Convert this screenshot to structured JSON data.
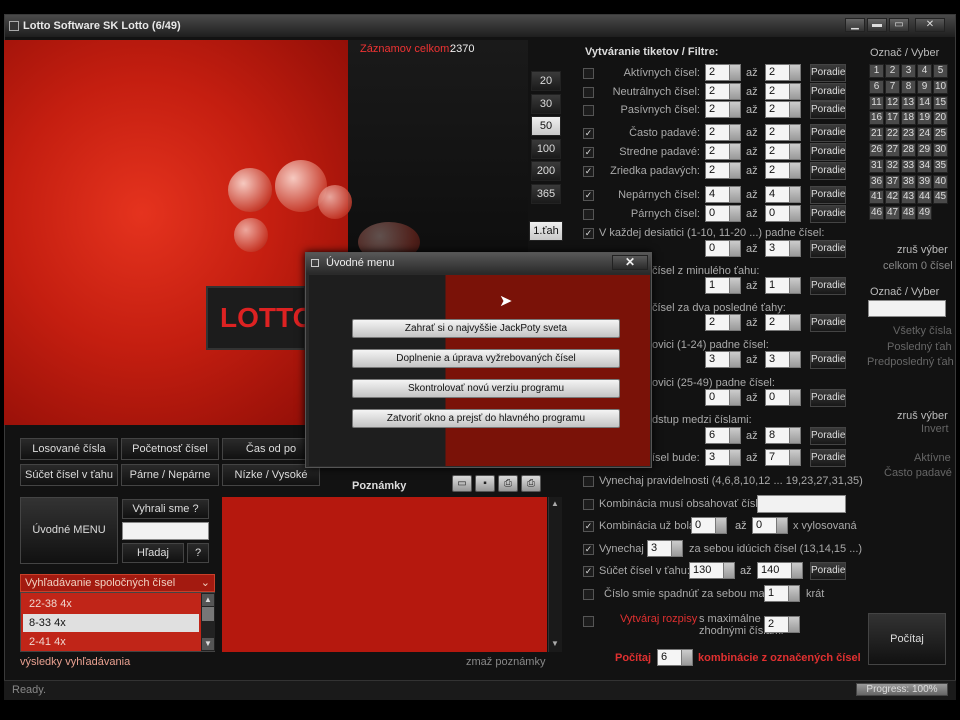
{
  "window": {
    "title": "Lotto Software SK Lotto (6/49)"
  },
  "records": {
    "label": "Záznamov celkom:",
    "value": "2370"
  },
  "logo_text": "LOTTO",
  "ranges": [
    "20",
    "30",
    "50",
    "100",
    "200",
    "365"
  ],
  "range_extra": "1.ťah",
  "nav_buttons": [
    "Losované čísla",
    "Početnosť čísel",
    "Čas od po",
    "Súčet čísel v ťahu",
    "Párne / Nepárne",
    "Nízke / Vysoké"
  ],
  "main_menu_label": "Úvodné MENU",
  "won_label": "Vyhrali sme ?",
  "search_label": "Hľadaj",
  "help_label": "?",
  "common_search": {
    "header": "Vyhľadávanie spoločných čísel",
    "items": [
      "22-38 4x",
      "8-33 4x",
      "2-41 4x"
    ],
    "selected": 1,
    "results_label": "výsledky vyhľadávania"
  },
  "notes": {
    "label": "Poznámky",
    "clear_label": "zmaž poznámky"
  },
  "filters": {
    "title": "Vytváranie tiketov / Filtre:",
    "to_label": "až",
    "order_label": "Poradie",
    "rows": [
      {
        "label": "Aktívnych čísel:",
        "from": "2",
        "to": "2",
        "checked": false
      },
      {
        "label": "Neutrálnych čísel:",
        "from": "2",
        "to": "2",
        "checked": false
      },
      {
        "label": "Pasívnych čísel:",
        "from": "2",
        "to": "2",
        "checked": false
      },
      {
        "label": "Často padavé:",
        "from": "2",
        "to": "2",
        "checked": true
      },
      {
        "label": "Stredne padavé:",
        "from": "2",
        "to": "2",
        "checked": true
      },
      {
        "label": "Zriedka padavých:",
        "from": "2",
        "to": "2",
        "checked": true
      },
      {
        "label": "Nepárnych čísel:",
        "from": "4",
        "to": "4",
        "checked": true
      },
      {
        "label": "Párnych čísel:",
        "from": "0",
        "to": "0",
        "checked": false
      }
    ],
    "decade_label": "V každej desiatici (1-10, 11-20 ...) padne čísel:",
    "decade_from": "0",
    "decade_to": "3",
    "prev_draw_label": "čísel z minulého ťahu:",
    "prev_draw_from": "1",
    "prev_draw_to": "1",
    "two_draws_label": "čísel za dva posledné ťahy:",
    "two_draws_from": "2",
    "two_draws_to": "2",
    "low_half_label": "ovici (1-24) padne čísel:",
    "low_half_from": "3",
    "low_half_to": "3",
    "high_half_label": "ovici (25-49) padne čísel:",
    "high_half_from": "0",
    "high_half_to": "0",
    "gap_label": "dstup medzi číslami:",
    "gap_from": "6",
    "gap_to": "8",
    "sum_label": "ísel bude:",
    "sum_from": "3",
    "sum_to": "7",
    "skip_pattern_label": "Vynechaj pravidelnosti (4,6,8,10,12 ... 19,23,27,31,35)",
    "must_contain_label": "Kombinácia musí obsahovať čísla:",
    "combo_was_label": "Kombinácia už bola",
    "combo_was_from": "0",
    "combo_was_to": "0",
    "combo_was_suffix": "x vylosovaná",
    "skip_consec_label": "Vynechaj",
    "skip_consec_value": "3",
    "skip_consec_suffix": "za sebou idúcich čísel (13,14,15 ...)",
    "draw_sum_label": "Súčet čísel v ťahu:",
    "draw_sum_from": "130",
    "draw_sum_to": "140",
    "fall_label": "Číslo smie spadnúť za sebou max:",
    "fall_value": "1",
    "fall_suffix": "krát",
    "spread_label": "Vytváraj rozpisy",
    "spread_suffix": "s maximálne zhodnými číslami",
    "spread_value": "2",
    "count_label": "Počítaj",
    "count_value": "6",
    "count_suffix": "kombinácie z označených čísel"
  },
  "selector": {
    "title": "Označ / Vyber",
    "numbers": [
      "1",
      "2",
      "3",
      "4",
      "5",
      "6",
      "7",
      "8",
      "9",
      "10",
      "11",
      "12",
      "13",
      "14",
      "15",
      "16",
      "17",
      "18",
      "19",
      "20",
      "21",
      "22",
      "23",
      "24",
      "25",
      "26",
      "27",
      "28",
      "29",
      "30",
      "31",
      "32",
      "33",
      "34",
      "35",
      "36",
      "37",
      "38",
      "39",
      "40",
      "41",
      "42",
      "43",
      "44",
      "45",
      "46",
      "47",
      "48",
      "49"
    ],
    "clear_label": "zruš výber",
    "marked_label": "celkom 0 čísel",
    "title2": "Označ / Vyber",
    "options": [
      "Všetky čísla",
      "Posledný ťah",
      "Predposledný ťah"
    ],
    "clear2_label": "zruš výber",
    "invert_label": "Invert",
    "active_label": "Aktívne",
    "frequent_label": "Často padavé",
    "compute_label": "Počítaj"
  },
  "dialog": {
    "title": "Úvodné menu",
    "close": "✕",
    "buttons": [
      "Zahrať si o najvyššie JackPoty sveta",
      "Doplnenie a úprava vyžrebovaných čísel",
      "Skontrolovať novú verziu programu",
      "Zatvoriť okno a prejsť do hlavného programu"
    ]
  },
  "status": {
    "text": "Ready.",
    "progress_label": "Progress: 100%",
    "progress_value": 1.0
  }
}
